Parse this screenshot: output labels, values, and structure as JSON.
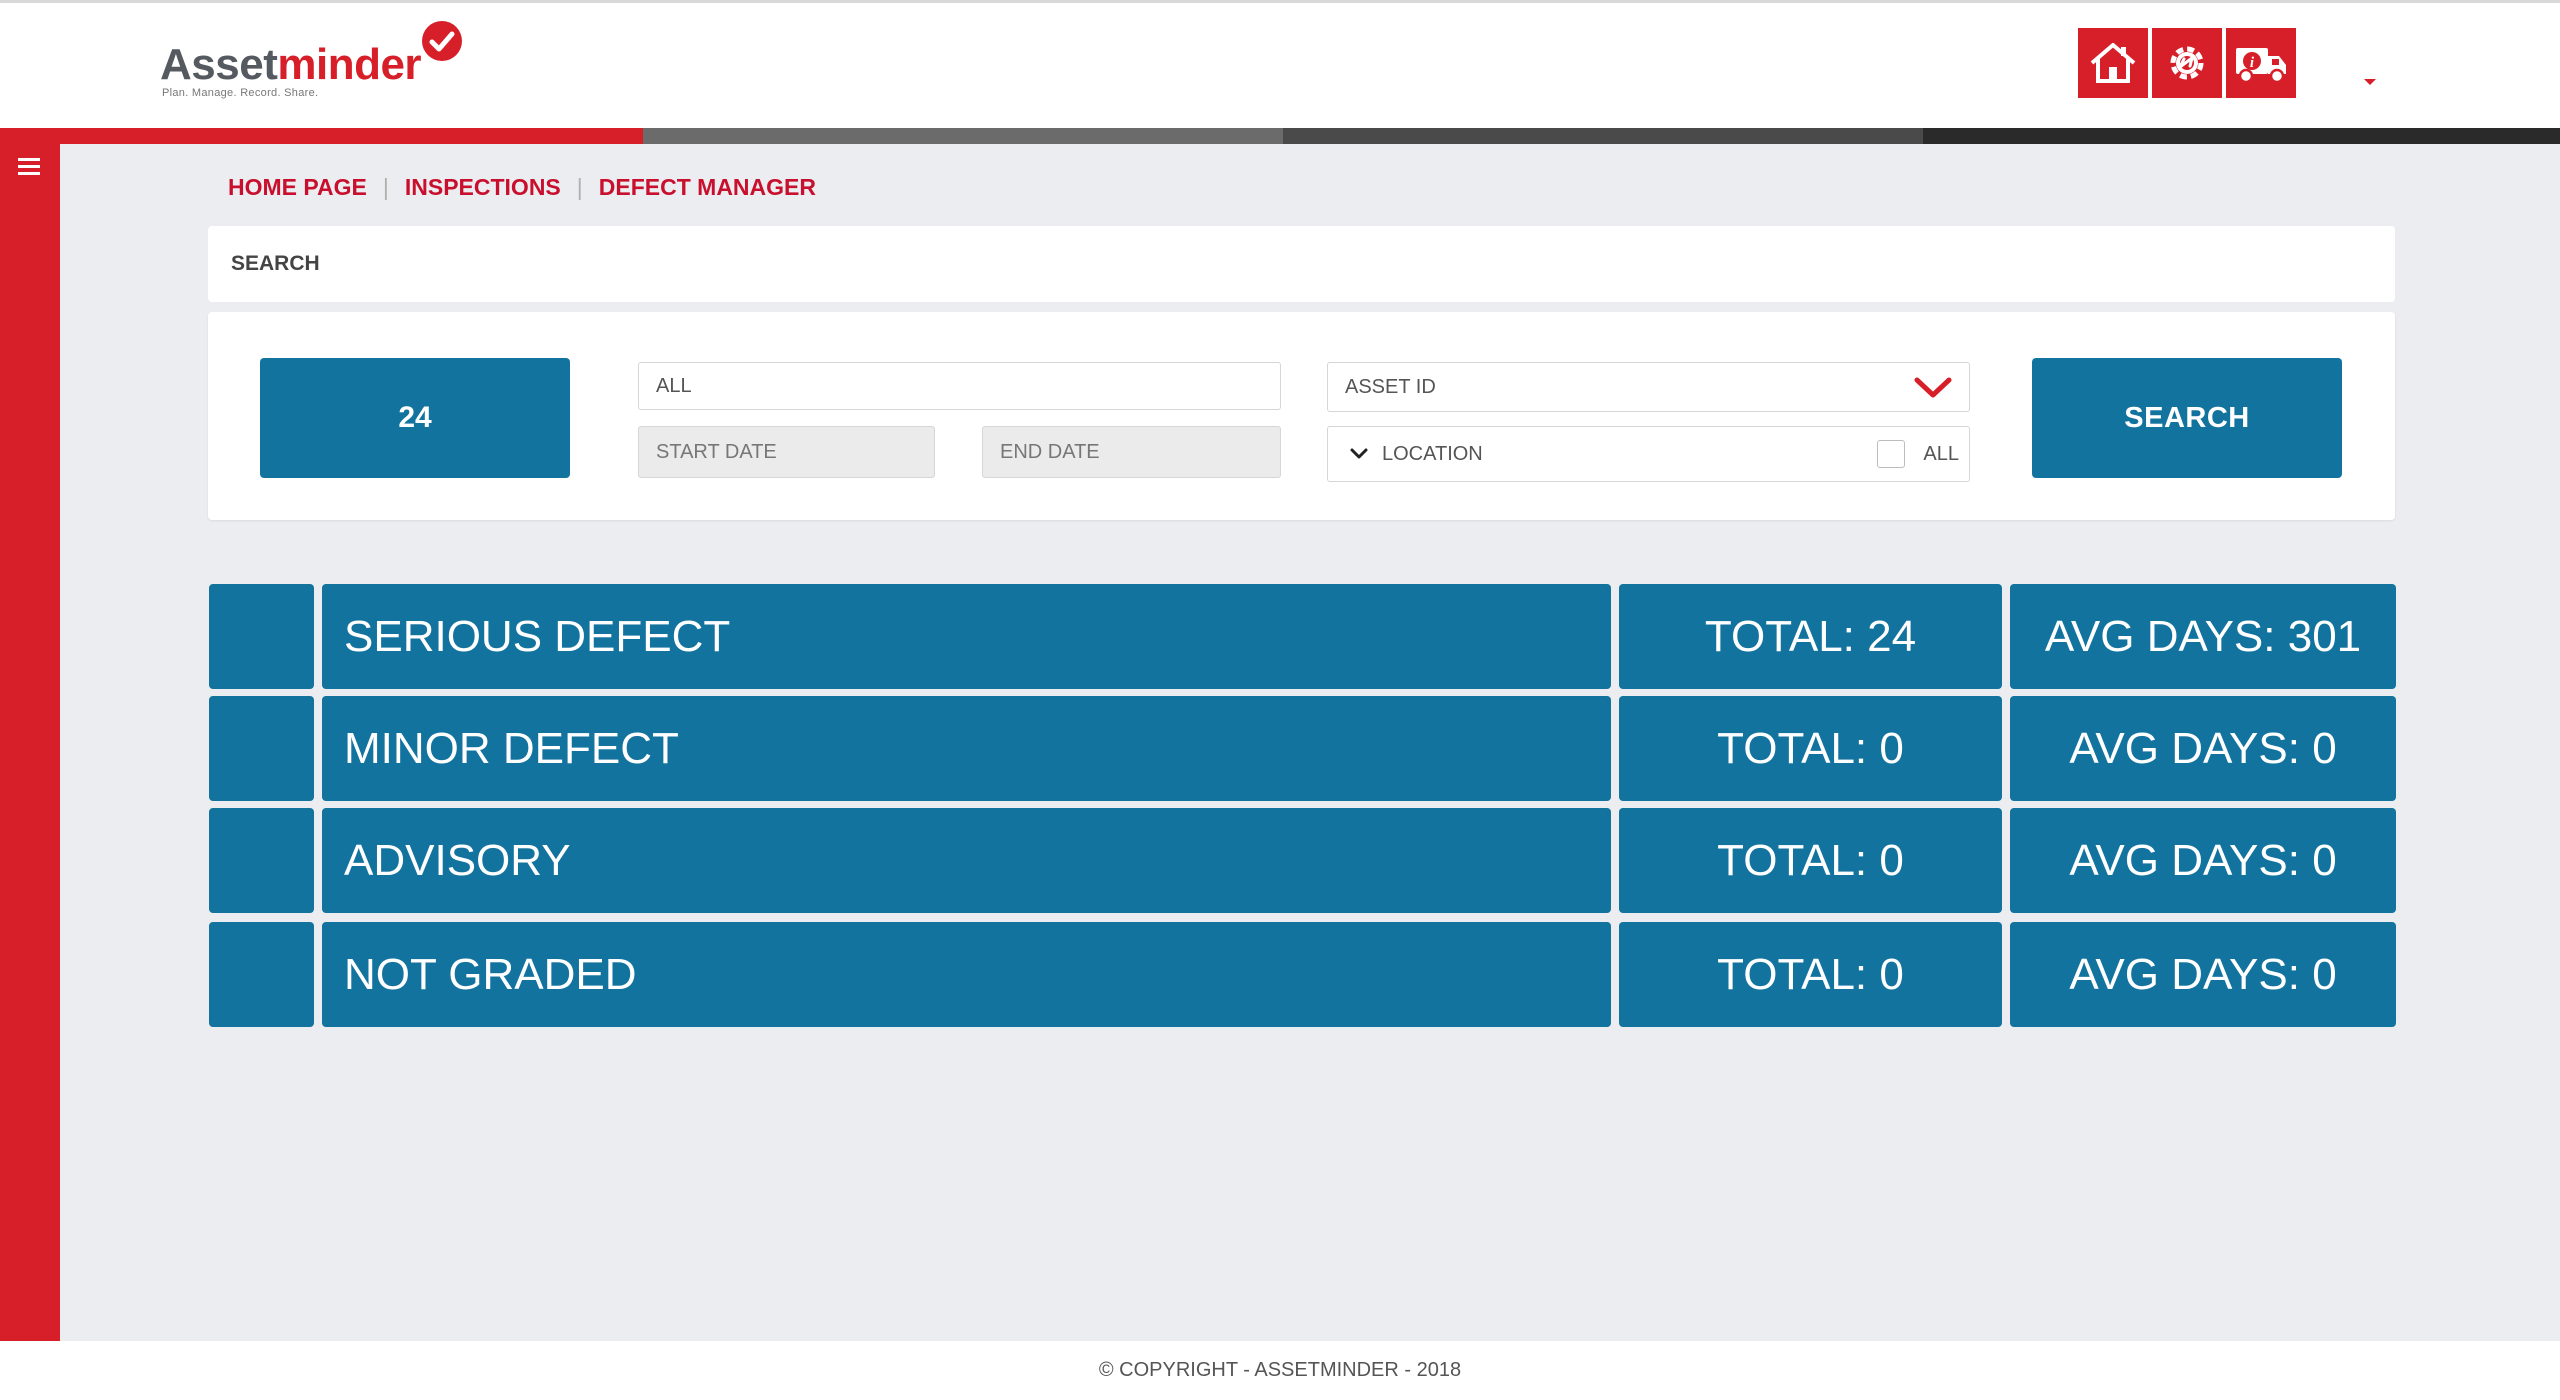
{
  "brand": {
    "name_part1": "Asset",
    "name_part2": "minder",
    "tagline": "Plan. Manage. Record. Share."
  },
  "header": {
    "buttons": [
      {
        "icon": "home-icon"
      },
      {
        "icon": "settings-gear-icon"
      },
      {
        "icon": "vehicle-info-icon"
      }
    ]
  },
  "colors": {
    "brand_red": "#d71f2a",
    "panel_blue": "#13739f",
    "background": "#ecedf0"
  },
  "breadcrumb": {
    "items": [
      "HOME PAGE",
      "INSPECTIONS",
      "DEFECT MANAGER"
    ],
    "separator": "|"
  },
  "search": {
    "header": "SEARCH",
    "count": "24",
    "filter_value": "ALL",
    "start_date_placeholder": "START DATE",
    "end_date_placeholder": "END DATE",
    "asset_select": "ASSET ID",
    "location_label": "LOCATION",
    "all_checkbox_label": "ALL",
    "button_label": "SEARCH"
  },
  "categories": [
    {
      "name": "SERIOUS DEFECT",
      "total": "TOTAL: 24",
      "avg": "AVG DAYS: 301"
    },
    {
      "name": "MINOR DEFECT",
      "total": "TOTAL: 0",
      "avg": "AVG DAYS: 0"
    },
    {
      "name": "ADVISORY",
      "total": "TOTAL: 0",
      "avg": "AVG DAYS: 0"
    },
    {
      "name": "NOT GRADED",
      "total": "TOTAL: 0",
      "avg": "AVG DAYS: 0"
    }
  ],
  "footer": {
    "copyright": "© COPYRIGHT - ASSETMINDER - 2018"
  }
}
